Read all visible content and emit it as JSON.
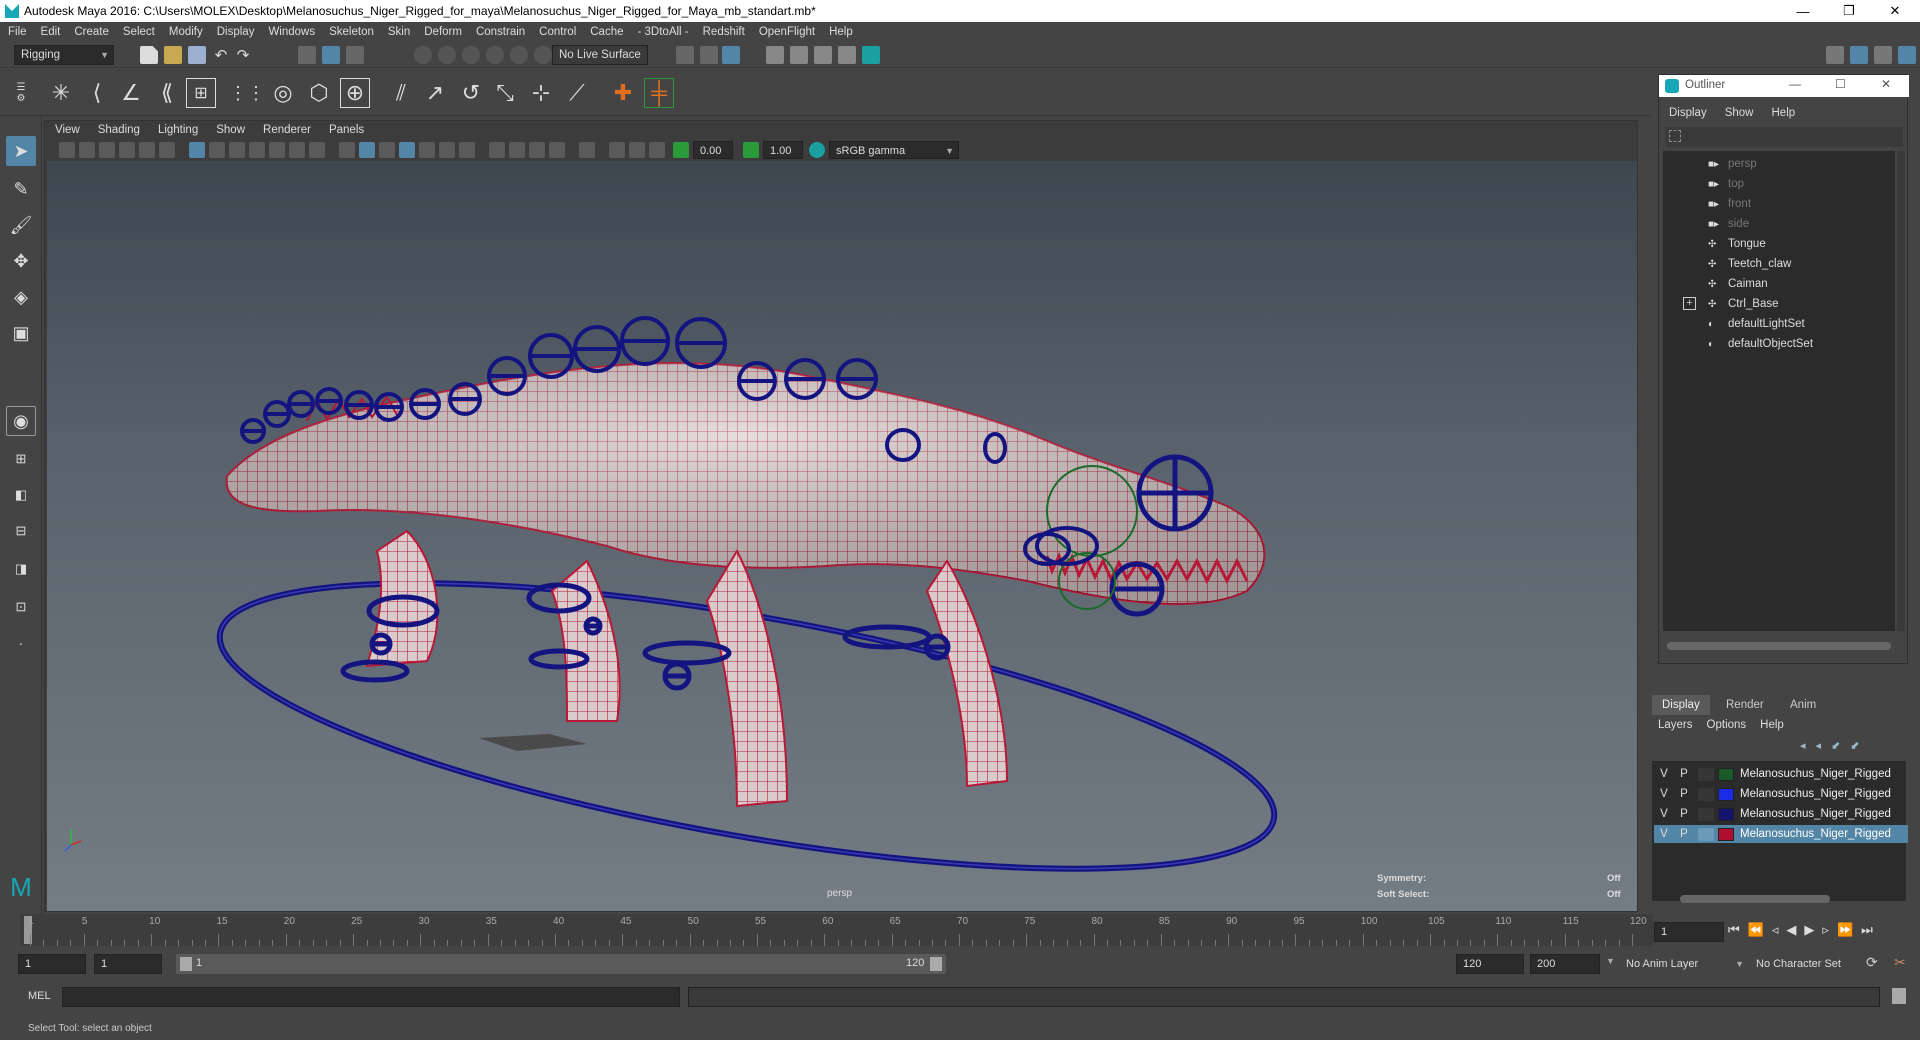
{
  "window": {
    "title": "Autodesk Maya 2016: C:\\Users\\MOLEX\\Desktop\\Melanosuchus_Niger_Rigged_for_maya\\Melanosuchus_Niger_Rigged_for_Maya_mb_standart.mb*",
    "minimize": "—",
    "restore": "❐",
    "close": "✕"
  },
  "menubar": [
    "File",
    "Edit",
    "Create",
    "Select",
    "Modify",
    "Display",
    "Windows",
    "Skeleton",
    "Skin",
    "Deform",
    "Constrain",
    "Control",
    "Cache",
    "- 3DtoAll -",
    "Redshift",
    "OpenFlight",
    "Help"
  ],
  "statusline": {
    "menuset": "Rigging",
    "live_surface": "No Live Surface"
  },
  "viewport": {
    "menu": [
      "View",
      "Shading",
      "Lighting",
      "Show",
      "Renderer",
      "Panels"
    ],
    "near_value": "0.00",
    "far_value": "1.00",
    "color_space": "sRGB gamma",
    "camera_label": "persp",
    "symmetry_label": "Symmetry:",
    "symmetry_value": "Off",
    "soft_select_label": "Soft Select:",
    "soft_select_value": "Off"
  },
  "outliner": {
    "title": "Outliner",
    "menu": [
      "Display",
      "Show",
      "Help"
    ],
    "items": [
      {
        "label": "persp",
        "icon": "camera-icon",
        "dim": true
      },
      {
        "label": "top",
        "icon": "camera-icon",
        "dim": true
      },
      {
        "label": "front",
        "icon": "camera-icon",
        "dim": true
      },
      {
        "label": "side",
        "icon": "camera-icon",
        "dim": true
      },
      {
        "label": "Tongue",
        "icon": "transform-icon",
        "dim": false
      },
      {
        "label": "Teetch_claw",
        "icon": "transform-icon",
        "dim": false
      },
      {
        "label": "Caiman",
        "icon": "transform-icon",
        "dim": false
      },
      {
        "label": "Ctrl_Base",
        "icon": "transform-icon",
        "dim": false,
        "expandable": true
      },
      {
        "label": "defaultLightSet",
        "icon": "set-icon",
        "dim": false
      },
      {
        "label": "defaultObjectSet",
        "icon": "set-icon",
        "dim": false
      }
    ]
  },
  "layers": {
    "tabs": [
      "Display",
      "Render",
      "Anim"
    ],
    "menu": [
      "Layers",
      "Options",
      "Help"
    ],
    "rows": [
      {
        "v": "V",
        "p": "P",
        "color": "#1a5a2a",
        "name": "Melanosuchus_Niger_Rigged",
        "selected": false
      },
      {
        "v": "V",
        "p": "P",
        "color": "#1a2ae6",
        "name": "Melanosuchus_Niger_Rigged",
        "selected": false
      },
      {
        "v": "V",
        "p": "P",
        "color": "#14146e",
        "name": "Melanosuchus_Niger_Rigged",
        "selected": false
      },
      {
        "v": "V",
        "p": "P",
        "color": "#b01030",
        "name": "Melanosuchus_Niger_Rigged",
        "selected": true
      }
    ]
  },
  "timeline": {
    "ticks": [
      "1",
      "5",
      "10",
      "15",
      "20",
      "25",
      "30",
      "35",
      "40",
      "45",
      "50",
      "55",
      "60",
      "65",
      "70",
      "75",
      "80",
      "85",
      "90",
      "95",
      "100",
      "105",
      "110",
      "115",
      "120"
    ],
    "current_frame": "1"
  },
  "range": {
    "start": "1",
    "playback_start": "1",
    "slider_start": "1",
    "slider_end": "120",
    "playback_end": "120",
    "end": "200",
    "anim_layer": "No Anim Layer",
    "character_set": "No Character Set"
  },
  "cmdline": {
    "label": "MEL"
  },
  "helpline": {
    "text": "Select Tool: select an object"
  },
  "colors": {
    "wire": "#b81838",
    "control": "#141480",
    "accent": "#5285a6"
  }
}
